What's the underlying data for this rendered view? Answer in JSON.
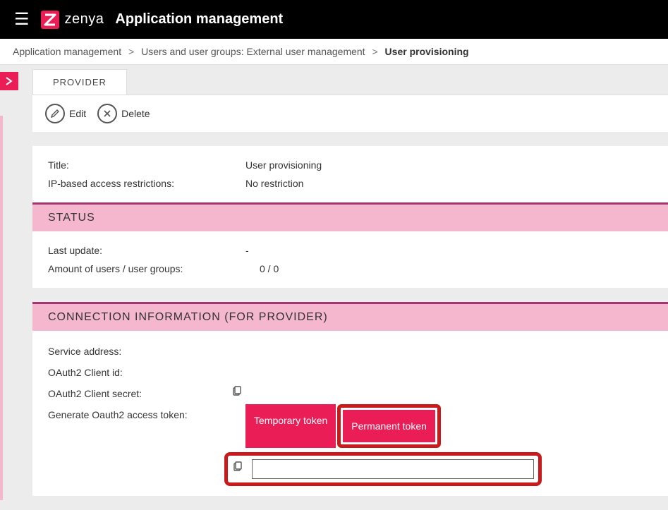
{
  "topbar": {
    "brand": "zenya",
    "page_title": "Application management"
  },
  "breadcrumb": {
    "items": [
      "Application management",
      "Users and user groups: External user management",
      "User provisioning"
    ]
  },
  "tab": {
    "label": "PROVIDER"
  },
  "actions": {
    "edit": "Edit",
    "delete": "Delete"
  },
  "info": {
    "title_label": "Title:",
    "title_value": "User provisioning",
    "ip_label": "IP-based access restrictions:",
    "ip_value": "No restriction"
  },
  "status": {
    "header": "STATUS",
    "last_update_label": "Last update:",
    "last_update_value": "-",
    "amount_label": "Amount of users / user groups:",
    "amount_value": "0 / 0"
  },
  "connection": {
    "header": "CONNECTION INFORMATION (FOR PROVIDER)",
    "service_address_label": "Service address:",
    "client_id_label": "OAuth2 Client id:",
    "client_secret_label": "OAuth2 Client secret:",
    "generate_label": "Generate Oauth2 access token:",
    "temporary_btn": "Temporary token",
    "permanent_btn": "Permanent token"
  }
}
